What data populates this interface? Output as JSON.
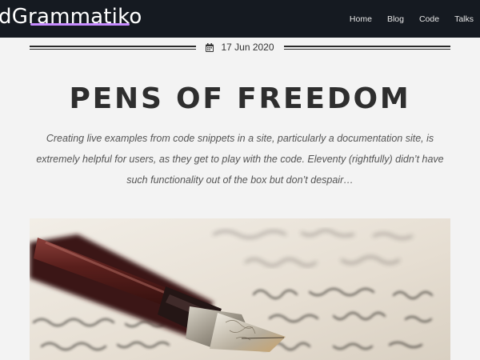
{
  "site": {
    "brand": "dGrammatiko",
    "nav": [
      "Home",
      "Blog",
      "Code",
      "Talks"
    ]
  },
  "post": {
    "date": "17 Jun 2020",
    "title": "PENS OF FREEDOM",
    "excerpt": "Creating live examples from code snippets in a site, particularly a documentation site, is extremely helpful for users, as they get to play with the code. Eleventy (rightfully) didn’t have such functionality out of the box but don’t despair…"
  },
  "colors": {
    "navbar_bg": "#151a21",
    "page_bg": "#f3f3f3",
    "brand_accent": "#c78bff"
  },
  "icons": {
    "date": "calendar-icon"
  }
}
